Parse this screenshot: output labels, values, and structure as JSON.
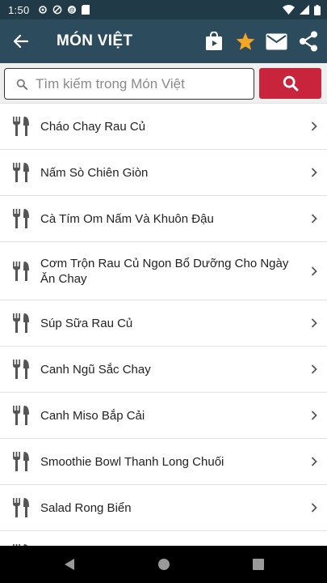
{
  "status_bar": {
    "time": "1:50"
  },
  "app_bar": {
    "title": "MÓN VIỆT"
  },
  "search": {
    "placeholder": "Tìm kiếm trong Món Việt",
    "value": ""
  },
  "colors": {
    "header": "#2c4b5c",
    "status": "#203a48",
    "accent_red": "#c8243b",
    "star": "#f5a623"
  },
  "icons": {
    "back": "arrow-left-icon",
    "shop": "shopping-bag-icon",
    "favorite": "star-icon",
    "mail": "envelope-icon",
    "share": "share-icon",
    "search": "search-icon",
    "item": "fork-knife-icon",
    "chevron": "chevron-right-icon"
  },
  "recipes": [
    {
      "label": "Cháo Chay Rau Củ"
    },
    {
      "label": "Nấm Sò Chiên Giòn"
    },
    {
      "label": "Cà Tím Om Nấm Và Khuôn Đậu"
    },
    {
      "label": "Cơm Trộn Rau Củ Ngon Bổ Dưỡng Cho Ngày Ăn Chay"
    },
    {
      "label": "Súp Sữa Rau Củ"
    },
    {
      "label": "Canh Ngũ Sắc Chay"
    },
    {
      "label": "Canh Miso Bắp Cải"
    },
    {
      "label": "Smoothie Bowl Thanh Long Chuối"
    },
    {
      "label": "Salad Rong Biển"
    },
    {
      "label": ""
    }
  ]
}
